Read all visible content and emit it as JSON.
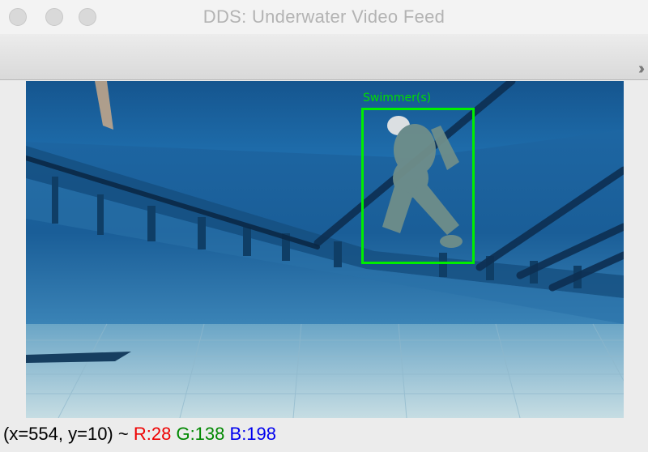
{
  "window": {
    "title": "DDS: Underwater Video Feed"
  },
  "toolbar": {
    "overflow_icon": "chevron-double-right-icon"
  },
  "detection": {
    "label": "Swimmer(s)",
    "color": "#00ee00"
  },
  "status": {
    "coords": "(x=554, y=10) ~",
    "r": "R:28",
    "g": "G:138",
    "b": "B:198"
  },
  "colors": {
    "water": "#1b5f97",
    "box": "#00ee00",
    "r": "#ee0000",
    "g": "#008800",
    "b": "#0000ee"
  }
}
